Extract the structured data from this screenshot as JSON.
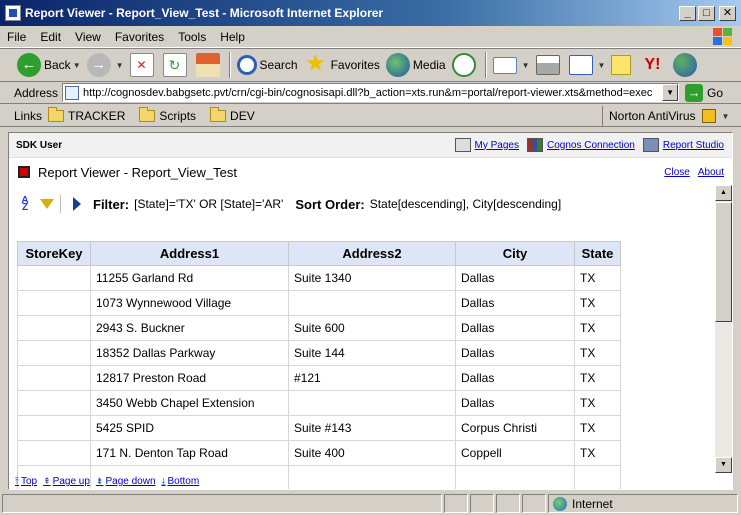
{
  "window": {
    "title": "Report Viewer - Report_View_Test - Microsoft Internet Explorer"
  },
  "menu": [
    "File",
    "Edit",
    "View",
    "Favorites",
    "Tools",
    "Help"
  ],
  "toolbar": {
    "back": "Back",
    "search": "Search",
    "favorites": "Favorites",
    "media": "Media"
  },
  "address": {
    "label": "Address",
    "url": "http://cognosdev.babgsetc.pvt/crn/cgi-bin/cognosisapi.dll?b_action=xts.run&m=portal/report-viewer.xts&method=exec",
    "go": "Go"
  },
  "links": {
    "label": "Links",
    "items": [
      "TRACKER",
      "Scripts",
      "DEV"
    ],
    "norton": "Norton AntiVirus"
  },
  "sdk": {
    "user": "SDK User",
    "my_pages": "My Pages",
    "cognos_connection": "Cognos Connection",
    "report_studio": "Report Studio"
  },
  "viewer": {
    "title": "Report Viewer - Report_View_Test",
    "close": "Close",
    "about": "About"
  },
  "filter": {
    "filter_label": "Filter:",
    "filter_value": "[State]='TX' OR [State]='AR'",
    "sort_label": "Sort Order:",
    "sort_value": "State[descending], City[descending]"
  },
  "table": {
    "headers": [
      "StoreKey",
      "Address1",
      "Address2",
      "City",
      "State"
    ],
    "rows": [
      [
        "",
        "11255 Garland Rd",
        "Suite 1340",
        "Dallas",
        "TX"
      ],
      [
        "",
        "1073 Wynnewood Village",
        "",
        "Dallas",
        "TX"
      ],
      [
        "",
        "2943 S. Buckner",
        "Suite 600",
        "Dallas",
        "TX"
      ],
      [
        "",
        "18352 Dallas Parkway",
        "Suite 144",
        "Dallas",
        "TX"
      ],
      [
        "",
        "12817 Preston Road",
        "#121",
        "Dallas",
        "TX"
      ],
      [
        "",
        "3450 Webb Chapel Extension",
        "",
        "Dallas",
        "TX"
      ],
      [
        "",
        "5425 SPID",
        "Suite #143",
        "Corpus Christi",
        "TX"
      ],
      [
        "",
        "171 N. Denton Tap Road",
        "Suite 400",
        "Coppell",
        "TX"
      ],
      [
        "",
        "",
        "",
        "",
        ""
      ]
    ]
  },
  "pagenav": {
    "top": "Top",
    "page_up": "Page up",
    "page_down": "Page down",
    "bottom": "Bottom"
  },
  "status": {
    "zone": "Internet"
  }
}
